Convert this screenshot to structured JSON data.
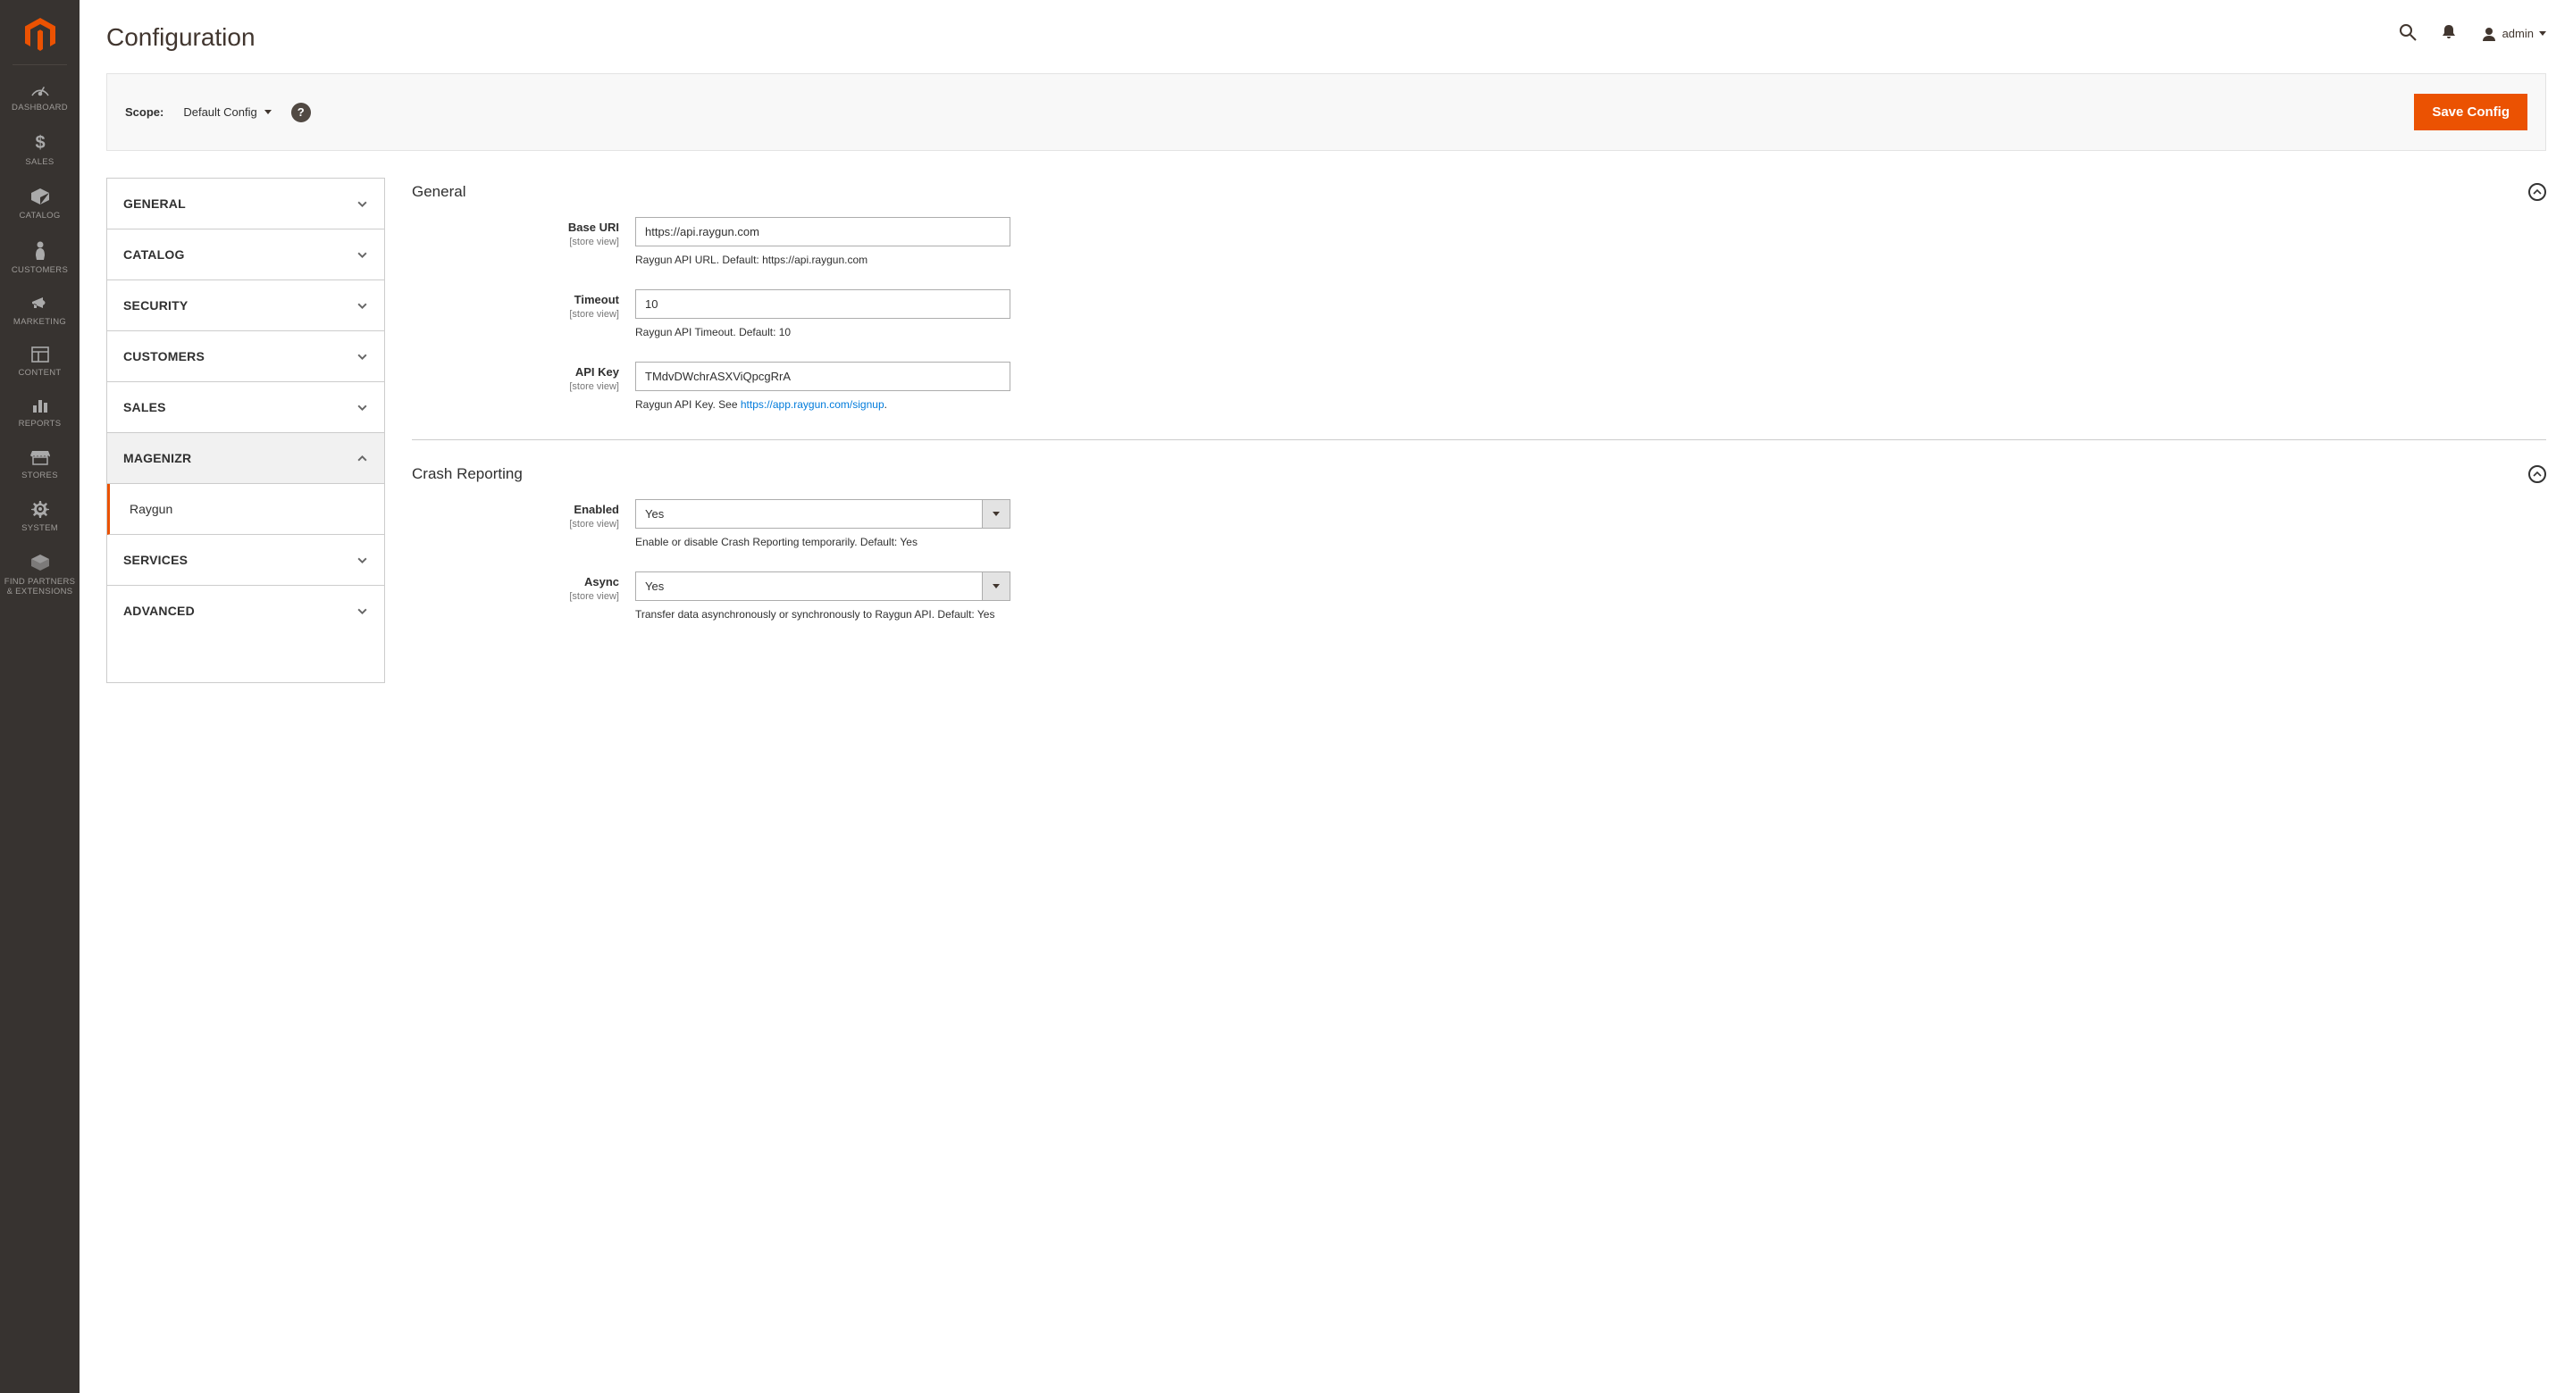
{
  "page_title": "Configuration",
  "topbar": {
    "user_name": "admin"
  },
  "scope_bar": {
    "label": "Scope:",
    "selected": "Default Config",
    "save_label": "Save Config"
  },
  "sidebar_nav": [
    {
      "label": "DASHBOARD"
    },
    {
      "label": "SALES"
    },
    {
      "label": "CATALOG"
    },
    {
      "label": "CUSTOMERS"
    },
    {
      "label": "MARKETING"
    },
    {
      "label": "CONTENT"
    },
    {
      "label": "REPORTS"
    },
    {
      "label": "STORES"
    },
    {
      "label": "SYSTEM"
    },
    {
      "label": "FIND PARTNERS & EXTENSIONS"
    }
  ],
  "config_tabs": [
    {
      "title": "GENERAL",
      "expanded": false
    },
    {
      "title": "CATALOG",
      "expanded": false
    },
    {
      "title": "SECURITY",
      "expanded": false
    },
    {
      "title": "CUSTOMERS",
      "expanded": false
    },
    {
      "title": "SALES",
      "expanded": false
    },
    {
      "title": "MAGENIZR",
      "expanded": true,
      "sub": "Raygun"
    },
    {
      "title": "SERVICES",
      "expanded": false
    },
    {
      "title": "ADVANCED",
      "expanded": false
    }
  ],
  "sections": {
    "general": {
      "title": "General",
      "fields": {
        "base_uri": {
          "label": "Base URI",
          "scope": "[store view]",
          "value": "https://api.raygun.com",
          "note": "Raygun API URL. Default: https://api.raygun.com"
        },
        "timeout": {
          "label": "Timeout",
          "scope": "[store view]",
          "value": "10",
          "note": "Raygun API Timeout. Default: 10"
        },
        "api_key": {
          "label": "API Key",
          "scope": "[store view]",
          "value": "TMdvDWchrASXViQpcgRrA",
          "note_pre": "Raygun API Key. See ",
          "note_link": "https://app.raygun.com/signup",
          "note_post": "."
        }
      }
    },
    "crash": {
      "title": "Crash Reporting",
      "fields": {
        "enabled": {
          "label": "Enabled",
          "scope": "[store view]",
          "value": "Yes",
          "note": "Enable or disable Crash Reporting temporarily. Default: Yes"
        },
        "async": {
          "label": "Async",
          "scope": "[store view]",
          "value": "Yes",
          "note": "Transfer data asynchronously or synchronously to Raygun API. Default: Yes"
        }
      }
    }
  }
}
